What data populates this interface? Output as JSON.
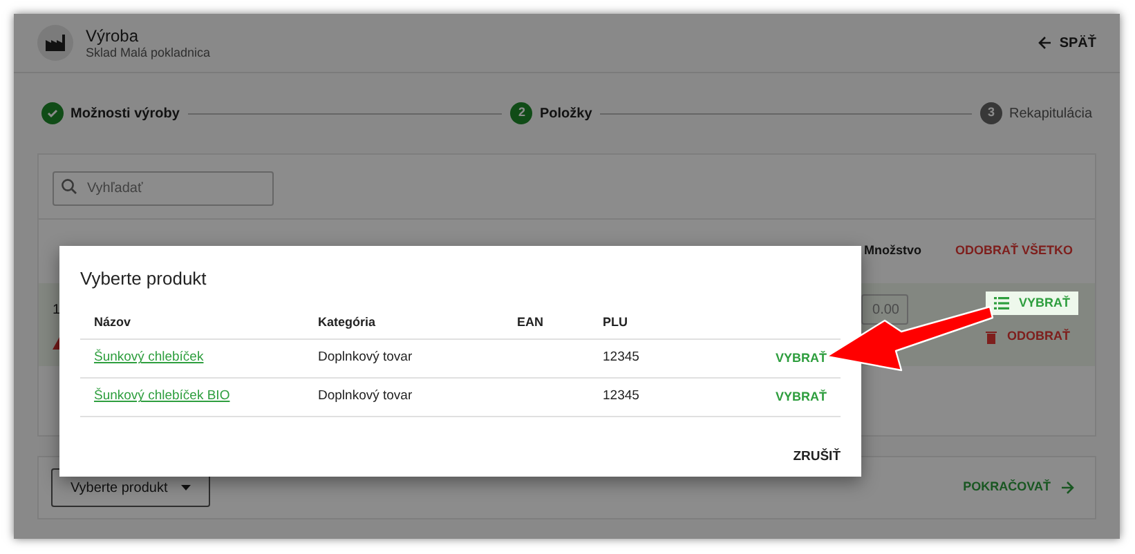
{
  "header": {
    "title": "Výroba",
    "subtitle": "Sklad Malá pokladnica",
    "back": "SPÄŤ"
  },
  "steps": [
    {
      "label": "Možnosti výroby",
      "kind": "done"
    },
    {
      "label": "Položky",
      "marker": "2",
      "kind": "active"
    },
    {
      "label": "Rekapitulácia",
      "marker": "3",
      "kind": "pending"
    }
  ],
  "search": {
    "placeholder": "Vyhľadať"
  },
  "items_table": {
    "quantity_column": "Množstvo",
    "remove_all": "ODOBRAŤ VŠETKO",
    "row": {
      "cell_1": "1",
      "warning": true,
      "quantity": "0.00",
      "select": "VYBRAŤ",
      "select_highlighted": true,
      "remove": "ODOBRAŤ"
    }
  },
  "footer": {
    "product_dropdown": "Vyberte produkt",
    "continue": "POKRAČOVAŤ"
  },
  "dialog": {
    "title": "Vyberte produkt",
    "columns": [
      "Názov",
      "Kategória",
      "EAN",
      "PLU"
    ],
    "rows": [
      {
        "name": "Šunkový chlebíček",
        "category": "Doplnkový tovar",
        "plu": "12345",
        "action": "VYBRAŤ"
      },
      {
        "name": "Šunkový chlebíček BIO",
        "category": "Doplnkový tovar",
        "plu": "12345",
        "action": "VYBRAŤ"
      }
    ],
    "cancel": "ZRUŠIŤ"
  }
}
